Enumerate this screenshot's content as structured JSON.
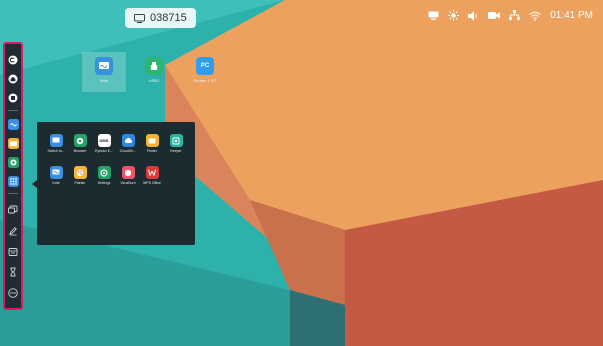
{
  "meeting": {
    "room_code": "038715"
  },
  "status_bar": {
    "time": "01:41 PM"
  },
  "desktop_icons": [
    {
      "label": "Note",
      "color": "#3a8fde",
      "icon": "whiteboard-icon"
    },
    {
      "label": "USB1",
      "color": "#2bb673",
      "icon": "usb-icon"
    },
    {
      "label": "Screen 1 PC",
      "color": "#2f9ef0",
      "icon": "pc-icon",
      "glyph": "PC"
    }
  ],
  "app_drawer": {
    "apps": [
      {
        "label": "Switch to...",
        "color": "#3c8ee0"
      },
      {
        "label": "Browser",
        "color": "#26a269"
      },
      {
        "label": "Eyesbo E...",
        "color": "#ffffff",
        "glyph": "DMS"
      },
      {
        "label": "CloudDri...",
        "color": "#2f86de"
      },
      {
        "label": "Finder",
        "color": "#f2b233"
      },
      {
        "label": "Keeper",
        "color": "#2bb3a0"
      },
      {
        "label": "Note",
        "color": "#3a8fde"
      },
      {
        "label": "Painter",
        "color": "#f4b63a"
      },
      {
        "label": "Settings",
        "color": "#26a269"
      },
      {
        "label": "VirusBurn",
        "color": "#e8556b"
      },
      {
        "label": "WPS Office",
        "color": "#d93a3a"
      }
    ]
  },
  "sidebar": {
    "items": [
      {
        "name": "back-icon"
      },
      {
        "name": "home-icon"
      },
      {
        "name": "multitask-icon"
      },
      {
        "name": "note-app-icon"
      },
      {
        "name": "folder-app-icon"
      },
      {
        "name": "browser-app-icon"
      },
      {
        "name": "apps-grid-icon"
      },
      {
        "name": "screen-mirror-icon"
      },
      {
        "name": "annotate-pen-icon"
      },
      {
        "name": "freeze-icon"
      },
      {
        "name": "timer-icon"
      },
      {
        "name": "more-icon"
      }
    ]
  },
  "colors": {
    "accent": "#d81b60",
    "sidebar_bg": "#222a33",
    "drawer_bg": "#1b2b2f"
  }
}
